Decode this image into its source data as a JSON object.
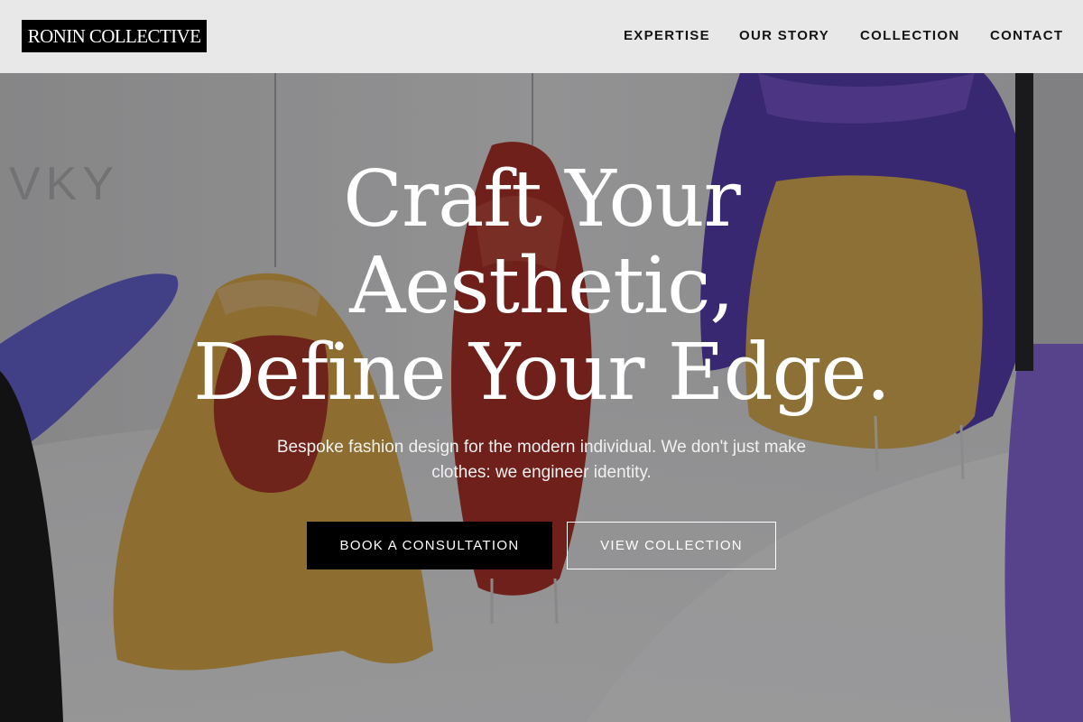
{
  "brand": {
    "logo_text": "RONIN COLLECTIVE"
  },
  "nav": {
    "items": [
      {
        "label": "EXPERTISE"
      },
      {
        "label": "OUR STORY"
      },
      {
        "label": "COLLECTION"
      },
      {
        "label": "CONTACT"
      }
    ]
  },
  "hero": {
    "headline_lines": [
      "Craft Your",
      "Aesthetic,",
      "Define Your Edge."
    ],
    "subtitle": "Bespoke fashion design for the modern individual. We don't just make clothes: we engineer identity.",
    "primary_button": "BOOK A CONSULTATION",
    "secondary_button": "VIEW COLLECTION",
    "background_text": "VKY"
  },
  "colors": {
    "header_bg": "#e8e8e9",
    "logo_bg": "#000000",
    "primary_button_bg": "#000000",
    "text_on_hero": "#ffffff"
  }
}
